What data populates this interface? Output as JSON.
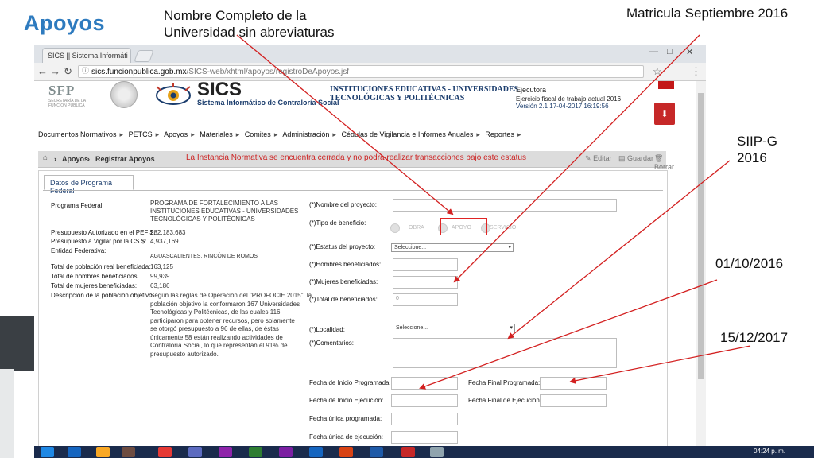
{
  "slide": {
    "title": "Apoyos",
    "annotations": {
      "nombre": "Nombre Completo  de la Universidad sin abreviaturas",
      "matricula": "Matricula Septiembre 2016",
      "siip": "SIIP-G 2016",
      "fecha_inicio": "01/10/2016",
      "fecha_final": "15/12/2017"
    },
    "arrow_color": "#d32020"
  },
  "browser": {
    "tab_title": "SICS || Sistema Informáti",
    "url_host": "sics.funcionpublica.gob.mx",
    "url_path": "/SICS-web/xhtml/apoyos/registroDeApoyos.jsf"
  },
  "site": {
    "sfp": "SFP",
    "sfp_sub": "SECRETARÍA DE LA FUNCIÓN PÚBLICA",
    "sics": "SICS",
    "sics_sub": "Sistema Informático de Contraloría Social",
    "inst_line1": "INSTITUCIONES EDUCATIVAS - UNIVERSIDADES",
    "inst_line2": "TECNOLÓGICAS Y POLITÉCNICAS",
    "ejecutora": "Ejecutora",
    "ejercicio": "Ejercicio fiscal de trabajo actual  2016",
    "version": "Versión 2.1   17-04-2017 16:19:56"
  },
  "nav": [
    "Documentos Normativos",
    "PETCS",
    "Apoyos",
    "Materiales",
    "Comites",
    "Administración",
    "Cédulas de Vigilancia e Informes Anuales",
    "Reportes"
  ],
  "breadcrumb": {
    "item1": "Apoyos",
    "item2": "Registrar Apoyos",
    "warning": "La Instancia Normativa se encuentra cerrada y no podra realizar transacciones bajo este estatus",
    "editar": "Editar",
    "guardar": "Guardar",
    "borrar": "Borrar"
  },
  "panel": {
    "tab": "Datos de Programa Federal",
    "left": {
      "programa_label": "Programa Federal:",
      "programa_lines": [
        "PROGRAMA DE FORTALECIMIENTO A LAS",
        "INSTITUCIONES EDUCATIVAS - UNIVERSIDADES",
        "TECNOLÓGICAS Y POLITÉCNICAS"
      ],
      "pef_label": "Presupuesto Autorizado en el PEF $:",
      "pef_value": "282,183,683",
      "cs_label": "Presupuesto a Vigilar por la CS $:",
      "cs_value": "4,937,169",
      "entidad_label": "Entidad Federativa:",
      "entidad_value": "AGUASCALIENTES,  RINCÓN DE ROMOS",
      "pob_label": "Total de población real beneficiada:",
      "pob_value": "163,125",
      "hom_label": "Total de hombres beneficiados:",
      "hom_value": "99,939",
      "muj_label": "Total de mujeres beneficiadas:",
      "muj_value": "63,186",
      "desc_label": "Descripción de la población objetivo:",
      "desc_lines": [
        "Según las reglas de Operación del \"PROFOCIE 2015\", la",
        "población objetivo la conformaron 167 Universidades",
        "Tecnológicas y Politécnicas, de las cuales 116",
        "participaron para obtener recursos, pero solamente",
        "se otorgó presupuesto a 96 de ellas, de éstas",
        "únicamente 58 están realizando actividades de",
        "Contraloría Social, lo que representan el 91% de",
        "presupuesto autorizado."
      ]
    },
    "right": {
      "nombre_label": "(*)Nombre del proyecto:",
      "tipo_label": "(*)Tipo de beneficio:",
      "obra": "OBRA",
      "apoyo": "APOYO",
      "servicio": "SERVICIO",
      "estatus_label": "(*)Estatus del proyecto:",
      "select_placeholder": "Seleccione...",
      "hombres_label": "(*)Hombres beneficiados:",
      "mujeres_label": "(*)Mujeres beneficiadas:",
      "total_label": "(*)Total de beneficiados:",
      "total_value": "0",
      "localidad_label": "(*)Localidad:",
      "comentarios_label": "(*)Comentarios:",
      "fip_label": "Fecha de Inicio Programada:",
      "ffp_label": "Fecha Final Programada:",
      "fie_label": "Fecha de Inicio Ejecución:",
      "ffe_label": "Fecha Final de Ejecución:",
      "fup_label": "Fecha única programada:",
      "fue_label": "Fecha única de ejecución:"
    }
  },
  "taskbar": {
    "clock": "04:24 p. m."
  }
}
